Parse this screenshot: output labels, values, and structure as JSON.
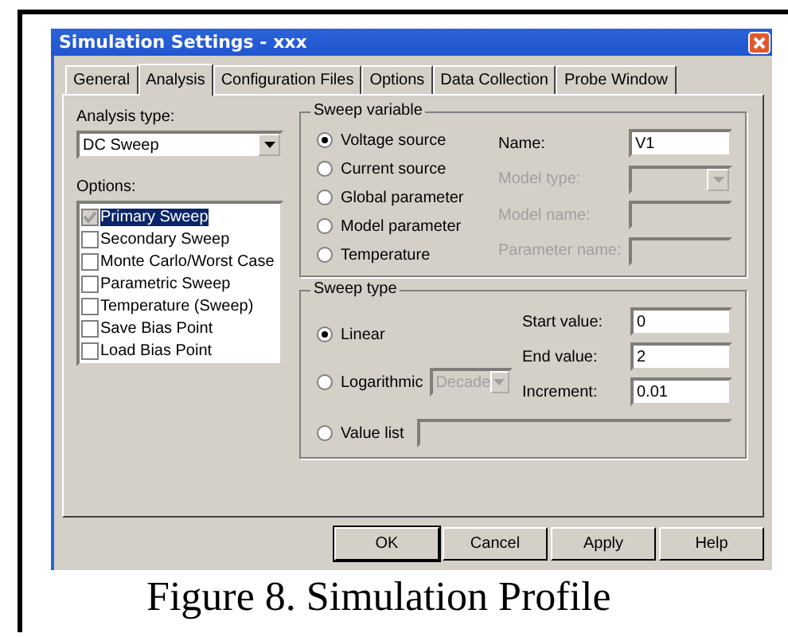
{
  "window": {
    "title": "Simulation Settings - xxx"
  },
  "tabs": [
    {
      "label": "General",
      "selected": false
    },
    {
      "label": "Analysis",
      "selected": true
    },
    {
      "label": "Configuration Files",
      "selected": false
    },
    {
      "label": "Options",
      "selected": false
    },
    {
      "label": "Data Collection",
      "selected": false
    },
    {
      "label": "Probe Window",
      "selected": false
    }
  ],
  "analysis_type": {
    "label": "Analysis type:",
    "value": "DC Sweep"
  },
  "options": {
    "label": "Options:",
    "items": [
      {
        "label": "Primary Sweep",
        "checked": true,
        "disabled": true,
        "selected": true
      },
      {
        "label": "Secondary Sweep",
        "checked": false,
        "disabled": false,
        "selected": false
      },
      {
        "label": "Monte Carlo/Worst Case",
        "checked": false,
        "disabled": false,
        "selected": false
      },
      {
        "label": "Parametric Sweep",
        "checked": false,
        "disabled": false,
        "selected": false
      },
      {
        "label": "Temperature (Sweep)",
        "checked": false,
        "disabled": false,
        "selected": false
      },
      {
        "label": "Save Bias Point",
        "checked": false,
        "disabled": false,
        "selected": false
      },
      {
        "label": "Load Bias Point",
        "checked": false,
        "disabled": false,
        "selected": false
      }
    ]
  },
  "sweep_variable": {
    "title": "Sweep variable",
    "radios": [
      {
        "label": "Voltage source",
        "selected": true
      },
      {
        "label": "Current source",
        "selected": false
      },
      {
        "label": "Global parameter",
        "selected": false
      },
      {
        "label": "Model parameter",
        "selected": false
      },
      {
        "label": "Temperature",
        "selected": false
      }
    ],
    "fields": [
      {
        "label": "Name:",
        "value": "V1",
        "disabled": false,
        "kind": "text"
      },
      {
        "label": "Model type:",
        "disabled": true,
        "kind": "dropdown"
      },
      {
        "label": "Model name:",
        "disabled": true,
        "kind": "text"
      },
      {
        "label": "Parameter name:",
        "disabled": true,
        "kind": "text"
      }
    ]
  },
  "sweep_type": {
    "title": "Sweep type",
    "linear": {
      "label": "Linear",
      "selected": true
    },
    "logarithmic": {
      "label": "Logarithmic",
      "selected": false,
      "scale": "Decade",
      "disabled": true
    },
    "fields": [
      {
        "label": "Start value:",
        "value": "0"
      },
      {
        "label": "End value:",
        "value": "2"
      },
      {
        "label": "Increment:",
        "value": "0.01"
      }
    ],
    "value_list": {
      "label": "Value list",
      "selected": false,
      "disabled": true
    }
  },
  "buttons": [
    {
      "label": "OK",
      "default": true
    },
    {
      "label": "Cancel",
      "default": false
    },
    {
      "label": "Apply",
      "default": false
    },
    {
      "label": "Help",
      "default": false
    }
  ],
  "caption": "Figure 8.  Simulation Profile"
}
